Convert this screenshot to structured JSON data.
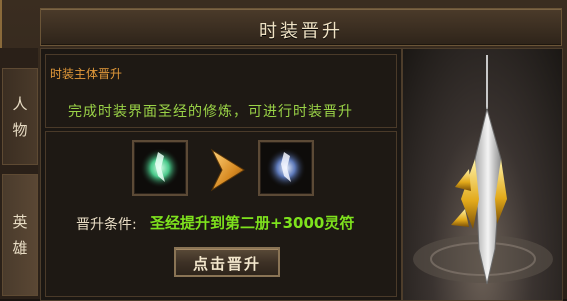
{
  "window": {
    "title": "时装晋升",
    "close_icon": "close-x"
  },
  "side_tabs": [
    {
      "chars": [
        "人",
        "物"
      ],
      "active": false
    },
    {
      "chars": [
        "英",
        "雄"
      ],
      "active": true
    }
  ],
  "subheader": {
    "label": "时装主体晋升",
    "description": "完成时装界面圣经的修炼，可进行时装晋升"
  },
  "upgrade": {
    "current_item_icon": "fashion-item-icon",
    "arrow_icon": "chevron-right-arrow",
    "next_item_icon": "fashion-item-upgraded-icon",
    "condition_label": "晋升条件:",
    "condition_value": "圣经提升到第二册+3000灵符",
    "button_label": "点击晋升"
  },
  "preview": {
    "item_icon": "sword-preview"
  },
  "colors": {
    "label_orange": "#e49a3a",
    "text_green": "#9ad347",
    "condition_green": "#7ee21d",
    "title_text": "#efe2c4"
  }
}
